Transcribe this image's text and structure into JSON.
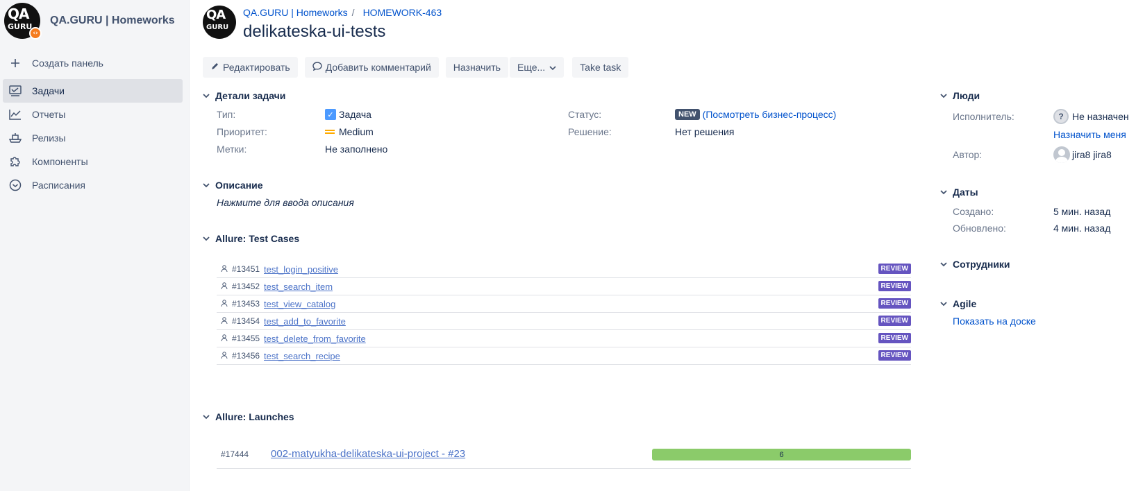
{
  "sidebar": {
    "project_name": "QA.GURU | Homeworks",
    "logo_text_top": "QA",
    "logo_text_bottom": "GURU",
    "items": [
      {
        "label": "Создать панель",
        "icon": "plus-icon"
      },
      {
        "label": "Задачи",
        "icon": "issues-icon",
        "active": true
      },
      {
        "label": "Отчеты",
        "icon": "chart-icon"
      },
      {
        "label": "Релизы",
        "icon": "ship-icon"
      },
      {
        "label": "Компоненты",
        "icon": "puzzle-icon"
      },
      {
        "label": "Расписания",
        "icon": "clock-icon"
      }
    ]
  },
  "header": {
    "breadcrumb_project": "QA.GURU | Homeworks",
    "breadcrumb_separator": "/",
    "breadcrumb_issue": "HOMEWORK-463",
    "title": "delikateska-ui-tests"
  },
  "toolbar": {
    "edit": "Редактировать",
    "comment": "Добавить комментарий",
    "assign": "Назначить",
    "more": "Еще...",
    "take_task": "Take task"
  },
  "details": {
    "section_title": "Детали задачи",
    "type_label": "Тип:",
    "type_value": "Задача",
    "priority_label": "Приоритет:",
    "priority_value": "Medium",
    "labels_label": "Метки:",
    "labels_value": "Не заполнено",
    "status_label": "Статус:",
    "status_badge": "NEW",
    "status_link": "(Посмотреть бизнес-процесс)",
    "resolution_label": "Решение:",
    "resolution_value": "Нет решения"
  },
  "description": {
    "section_title": "Описание",
    "placeholder": "Нажмите для ввода описания"
  },
  "test_cases": {
    "section_title": "Allure: Test Cases",
    "rows": [
      {
        "id": "#13451",
        "name": "test_login_positive",
        "status": "REVIEW"
      },
      {
        "id": "#13452",
        "name": "test_search_item",
        "status": "REVIEW"
      },
      {
        "id": "#13453",
        "name": "test_view_catalog",
        "status": "REVIEW"
      },
      {
        "id": "#13454",
        "name": "test_add_to_favorite",
        "status": "REVIEW"
      },
      {
        "id": "#13455",
        "name": "test_delete_from_favorite",
        "status": "REVIEW"
      },
      {
        "id": "#13456",
        "name": "test_search_recipe",
        "status": "REVIEW"
      }
    ]
  },
  "launches": {
    "section_title": "Allure: Launches",
    "row": {
      "id": "#17444",
      "name": "002-matyukha-delikateska-ui-project - #23",
      "passed": "6",
      "passed_fraction": 1.0
    }
  },
  "people": {
    "section_title": "Люди",
    "assignee_label": "Исполнитель:",
    "assignee_value": "Не назначен",
    "assign_me": "Назначить меня",
    "reporter_label": "Автор:",
    "reporter_value": "jira8 jira8"
  },
  "dates": {
    "section_title": "Даты",
    "created_label": "Создано:",
    "created_value": "5 мин. назад",
    "updated_label": "Обновлено:",
    "updated_value": "4 мин. назад"
  },
  "staff": {
    "section_title": "Сотрудники"
  },
  "agile": {
    "section_title": "Agile",
    "board_link": "Показать на доске"
  },
  "colors": {
    "accent": "#0052cc",
    "review": "#6554c0",
    "progress": "#8bcb6a",
    "status_new": "#42526e"
  }
}
